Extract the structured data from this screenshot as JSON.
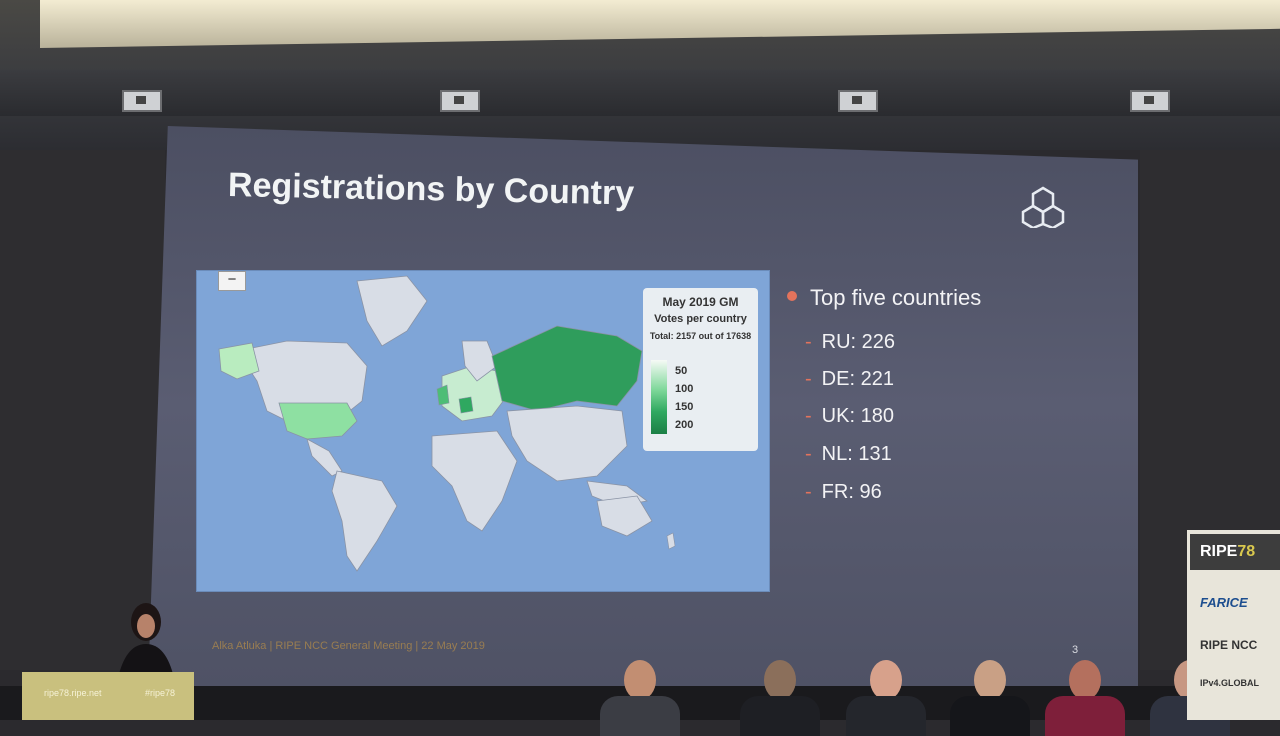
{
  "slide": {
    "title": "Registrations by Country",
    "footer": "Alka Atluka | RIPE NCC General Meeting | 22 May 2019",
    "page_number": "3"
  },
  "map": {
    "zoom_label": "−",
    "legend": {
      "title": "May 2019 GM",
      "subtitle": "Votes per country",
      "total": "Total: 2157 out of 17638",
      "ticks": [
        "50",
        "100",
        "150",
        "200"
      ]
    }
  },
  "top_countries": {
    "heading": "Top five countries",
    "items": [
      {
        "label": "RU: 226"
      },
      {
        "label": "DE: 221"
      },
      {
        "label": "UK: 180"
      },
      {
        "label": "NL: 131"
      },
      {
        "label": "FR: 96"
      }
    ]
  },
  "venue": {
    "lectern_url": "ripe78.ripe.net",
    "lectern_tag": "#ripe78",
    "banner_title": "RIPE",
    "banner_number": "78",
    "sponsors": [
      "FARICE",
      "RIPE NCC",
      "IPv4.GLOBAL"
    ]
  },
  "colors": {
    "ocean": "#7fa5d7",
    "land_default": "#d8dde6",
    "bullet_accent": "#e3735c",
    "scale_high": "#1c7f46"
  }
}
